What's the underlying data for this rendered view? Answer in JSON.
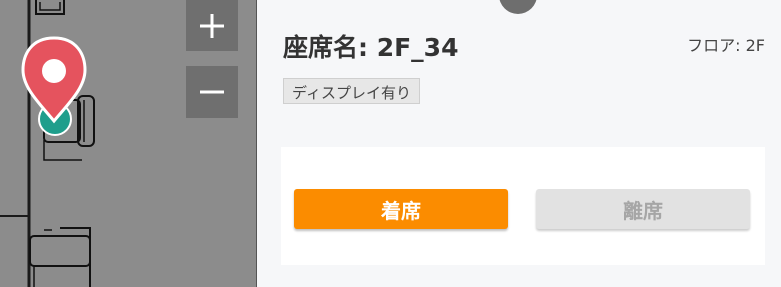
{
  "map": {
    "zoom_in_label": "+",
    "zoom_out_label": "−",
    "marker_color": "#e5535e",
    "seat_dot_color": "#1f9e8c"
  },
  "panel": {
    "seat_title": "座席名: 2F_34",
    "floor_label": "フロア: 2F",
    "tag": "ディスプレイ有り",
    "checkin_label": "着席",
    "checkout_label": "離席",
    "checkin_color": "#fb8c00",
    "checkout_color": "#e2e2e2"
  }
}
